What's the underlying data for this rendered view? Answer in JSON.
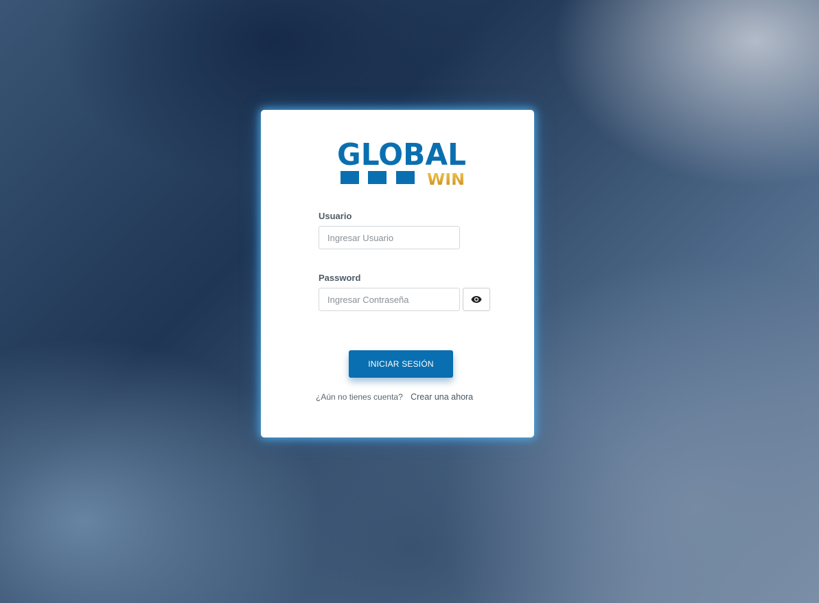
{
  "brand": {
    "name_main": "GLOBAL",
    "name_sub": "WIN",
    "primary_color": "#0a6fb0",
    "accent_color": "#e0a82e"
  },
  "form": {
    "username_label": "Usuario",
    "username_placeholder": "Ingresar Usuario",
    "username_value": "",
    "password_label": "Password",
    "password_placeholder": "Ingresar Contraseña",
    "password_value": "",
    "toggle_icon": "eye-icon"
  },
  "actions": {
    "login_label": "INICIAR SESIÓN",
    "signup_prompt": "¿Aún no tienes cuenta?",
    "signup_link": "Crear una ahora"
  }
}
